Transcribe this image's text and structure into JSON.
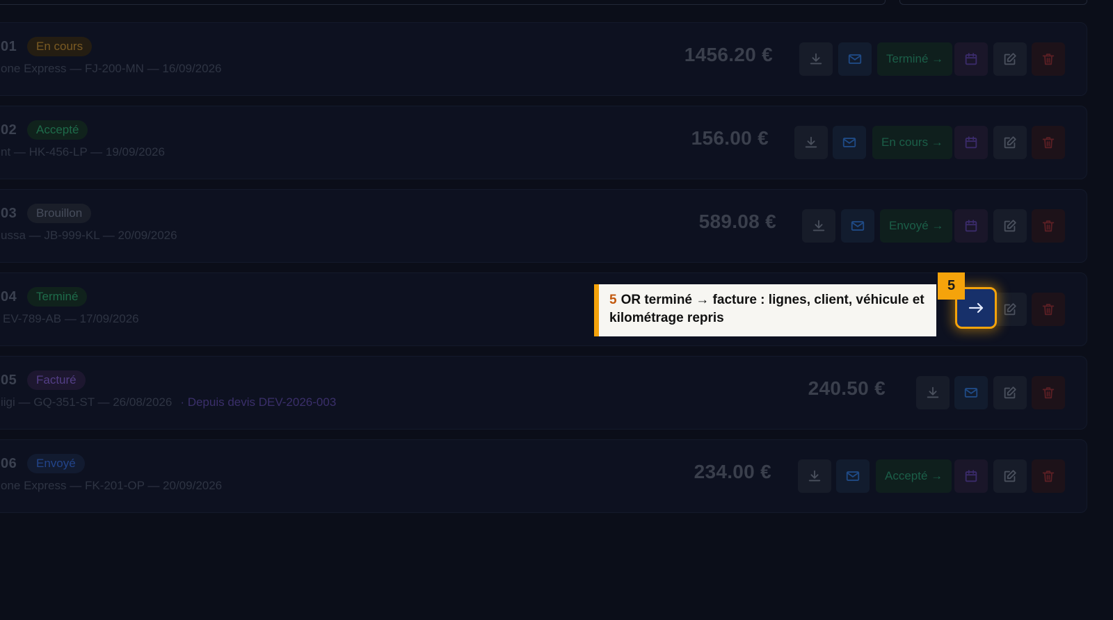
{
  "rows": [
    {
      "num": "01",
      "status": "En cours",
      "meta": "one Express — FJ-200-MN — 16/09/2026",
      "price": "1456.20 €",
      "next": "Terminé →"
    },
    {
      "num": "02",
      "status": "Accepté",
      "meta": "nt — HK-456-LP — 19/09/2026",
      "price": "156.00 €",
      "next": "En cours →"
    },
    {
      "num": "03",
      "status": "Brouillon",
      "meta": "ussa — JB-999-KL — 20/09/2026",
      "price": "589.08 €",
      "next": "Envoyé →"
    },
    {
      "num": "04",
      "status": "Terminé",
      "meta": "EV-789-AB — 17/09/2026"
    },
    {
      "num": "05",
      "status": "Facturé",
      "meta": "iigi — GQ-351-ST — 26/08/2026",
      "meta_link": "· Depuis devis DEV-2026-003",
      "price": "240.50 €"
    },
    {
      "num": "06",
      "status": "Envoyé",
      "meta": "one Express — FK-201-OP — 20/09/2026",
      "price": "234.00 €",
      "next": "Accepté →"
    }
  ],
  "tour": {
    "step": "5",
    "text": "OR terminé → facture : lignes, client, véhicule et kilométrage repris"
  },
  "colors": {
    "accent": "#f5a30b",
    "background": "#0b0e19"
  }
}
